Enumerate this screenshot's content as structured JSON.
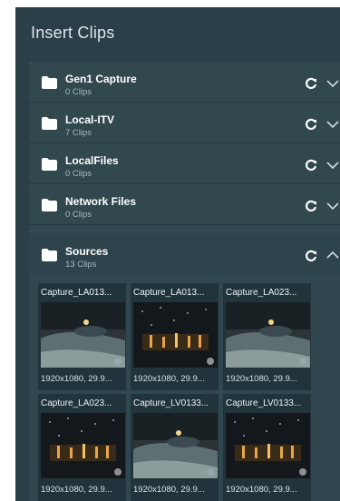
{
  "panel": {
    "title": "Insert Clips"
  },
  "sources": [
    {
      "name": "Gen1 Capture",
      "count": "0 Clips"
    },
    {
      "name": "Local-ITV",
      "count": "7 Clips"
    },
    {
      "name": "LocalFiles",
      "count": "0 Clips"
    },
    {
      "name": "Network Files",
      "count": "0 Clips"
    },
    {
      "name": "Sources",
      "count": "13 Clips"
    }
  ],
  "clips": [
    {
      "title": "Capture_LA013...",
      "meta": "1920x1080, 29.9...",
      "thumb": "car"
    },
    {
      "title": "Capture_LA013...",
      "meta": "1920x1080, 29.9...",
      "thumb": "stage"
    },
    {
      "title": "Capture_LA023...",
      "meta": "1920x1080, 29.9...",
      "thumb": "car"
    },
    {
      "title": "Capture_LA023...",
      "meta": "1920x1080, 29.9...",
      "thumb": "stage"
    },
    {
      "title": "Capture_LV0133...",
      "meta": "1920x1080, 29.9...",
      "thumb": "car"
    },
    {
      "title": "Capture_LV0133...",
      "meta": "1920x1080, 29.9...",
      "thumb": "stage"
    }
  ],
  "icons": {
    "folder": "folder-icon",
    "refresh": "refresh-icon",
    "chevron": "chevron-icon"
  }
}
